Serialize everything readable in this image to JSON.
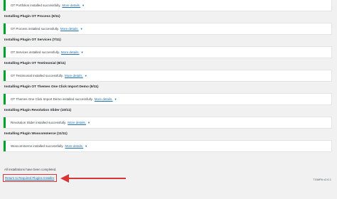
{
  "blocks": [
    {
      "heading": "",
      "notice": "OT Portfolios installed successfully.",
      "more": "More details."
    },
    {
      "heading": "Installing Plugin OT Process (6/11)",
      "notice": "OT Process installed successfully.",
      "more": "More details."
    },
    {
      "heading": "Installing Plugin OT Services (7/11)",
      "notice": "OT Services installed successfully.",
      "more": "More details."
    },
    {
      "heading": "Installing Plugin OT Testimonial (8/11)",
      "notice": "OT Testimonial installed successfully.",
      "more": "More details."
    },
    {
      "heading": "Installing Plugin OT Themes One Click Import Demo (9/11)",
      "notice": "OT Themes One Click Import Demo installed successfully.",
      "more": "More details."
    },
    {
      "heading": "Installing Plugin Revolution Slider (10/11)",
      "notice": "Revolution Slider installed successfully.",
      "more": "More details."
    },
    {
      "heading": "Installing Plugin Woocommerce (11/11)",
      "notice": "Woocommerce installed successfully.",
      "more": "More details."
    }
  ],
  "footer": {
    "complete_text": "All installations have been completed.",
    "return_link": "Return to Required Plugins Installer",
    "version": "TGMPA v2.6.1"
  },
  "colors": {
    "success": "#00a32a",
    "link": "#2271b1",
    "highlight": "#d63638"
  },
  "icons": {
    "toggle": "triangle-down-icon",
    "annotation": "arrow-left-icon"
  }
}
